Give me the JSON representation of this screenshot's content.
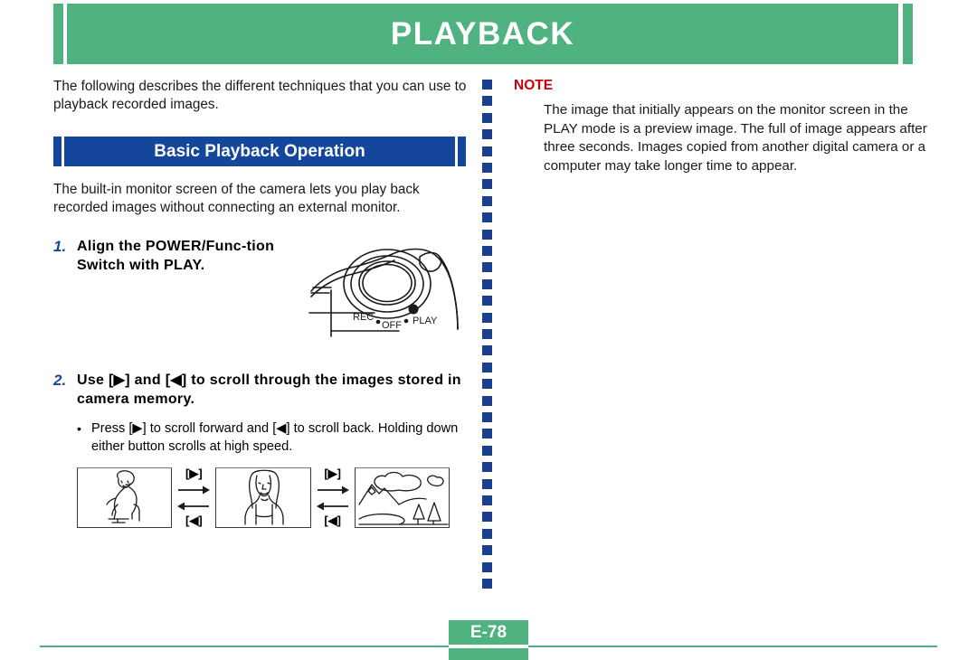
{
  "header": {
    "title": "PLAYBACK"
  },
  "left": {
    "intro_paragraph": "The following describes the different techniques that you can use to playback recorded images.",
    "section_title": "Basic Playback Operation",
    "section_paragraph": "The built-in monitor screen of the camera lets you play back recorded images without connecting an external monitor.",
    "steps": [
      {
        "number": "1.",
        "text": "Align the POWER/Func-tion Switch with PLAY."
      },
      {
        "number": "2.",
        "text": "Use [▶] and [◀] to scroll through the images stored in camera memory."
      }
    ],
    "bullet": {
      "marker": "•",
      "text": "Press [▶] to scroll forward and [◀] to scroll back. Holding down either button scrolls at high speed."
    }
  },
  "camera_figure": {
    "labels": {
      "rec": "REC",
      "off": "OFF",
      "play": "PLAY"
    }
  },
  "thumbnails": {
    "items": [
      {
        "alt": "person-sitting-on-chair-thumbnail"
      },
      {
        "alt": "portrait-of-woman-thumbnail"
      },
      {
        "alt": "mountain-landscape-thumbnail"
      }
    ],
    "arrows": [
      {
        "forward_label": "[▶]",
        "back_label": "[◀]"
      },
      {
        "forward_label": "[▶]",
        "back_label": "[◀]"
      }
    ]
  },
  "note": {
    "title": "NOTE",
    "body": "The image that initially appears on the monitor screen in the PLAY mode is a preview image. The full of image appears after three seconds. Images copied from another digital camera or a computer may take longer time to appear."
  },
  "footer": {
    "page_label": "E-78"
  },
  "colors": {
    "header_green": "#4FB280",
    "section_blue": "#14479B",
    "divider_blue": "#1a3f8f",
    "note_red": "#CC0000",
    "text_black": "#1a1a1a"
  }
}
